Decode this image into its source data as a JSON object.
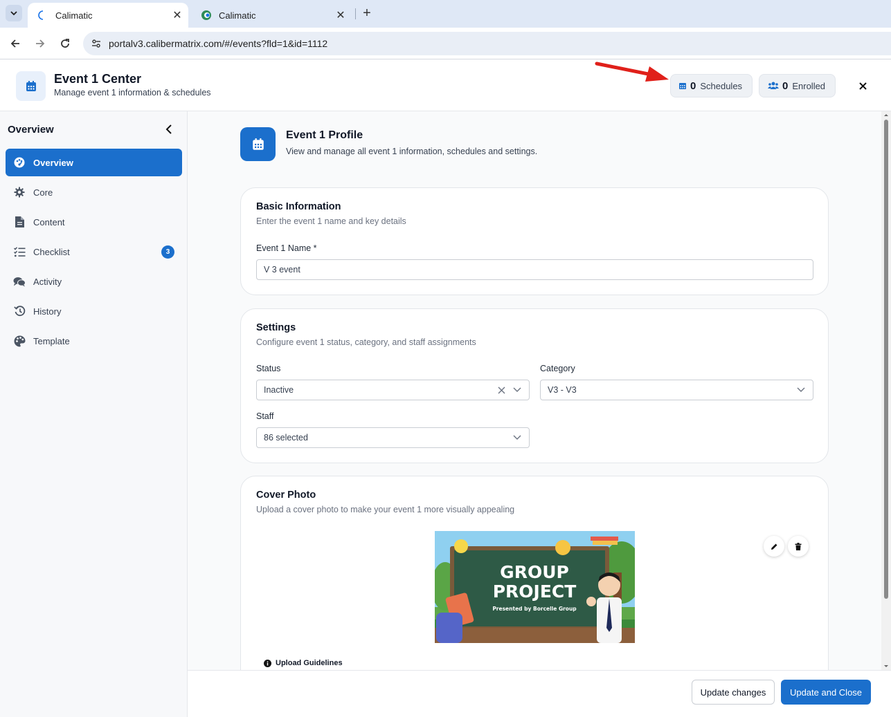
{
  "browser": {
    "tabs": [
      {
        "title": "Calimatic",
        "active": true
      },
      {
        "title": "Calimatic",
        "active": false
      }
    ],
    "url": "portalv3.calibermatrix.com/#/events?fld=1&id=1112"
  },
  "header": {
    "title": "Event 1 Center",
    "subtitle": "Manage event 1 information & schedules",
    "schedules_count": "0",
    "schedules_label": "Schedules",
    "enrolled_count": "0",
    "enrolled_label": "Enrolled"
  },
  "sidebar": {
    "heading": "Overview",
    "items": [
      {
        "label": "Overview",
        "icon": "palette-dashboard-icon",
        "active": true
      },
      {
        "label": "Core",
        "icon": "gear-icon"
      },
      {
        "label": "Content",
        "icon": "document-icon"
      },
      {
        "label": "Checklist",
        "icon": "checklist-icon",
        "badge": "3"
      },
      {
        "label": "Activity",
        "icon": "comments-icon"
      },
      {
        "label": "History",
        "icon": "history-icon"
      },
      {
        "label": "Template",
        "icon": "palette-icon"
      }
    ]
  },
  "profile": {
    "title": "Event 1 Profile",
    "subtitle": "View and manage all event 1 information, schedules and settings."
  },
  "basic_info": {
    "title": "Basic Information",
    "subtitle": "Enter the event 1 name and key details",
    "name_label": "Event 1 Name *",
    "name_value": "V 3 event"
  },
  "settings": {
    "title": "Settings",
    "subtitle": "Configure event 1 status, category, and staff assignments",
    "status_label": "Status",
    "status_value": "Inactive",
    "category_label": "Category",
    "category_value": "V3 - V3",
    "staff_label": "Staff",
    "staff_value": "86 selected"
  },
  "cover_photo": {
    "title": "Cover Photo",
    "subtitle": "Upload a cover photo to make your event 1 more visually appealing",
    "image_heading_1": "GROUP",
    "image_heading_2": "PROJECT",
    "image_caption": "Presented by Borcelle Group",
    "guidelines_label": "Upload Guidelines"
  },
  "footer": {
    "update_label": "Update changes",
    "update_close_label": "Update and Close"
  },
  "colors": {
    "primary": "#1b6fcc",
    "annotation_arrow": "#e0201a"
  }
}
